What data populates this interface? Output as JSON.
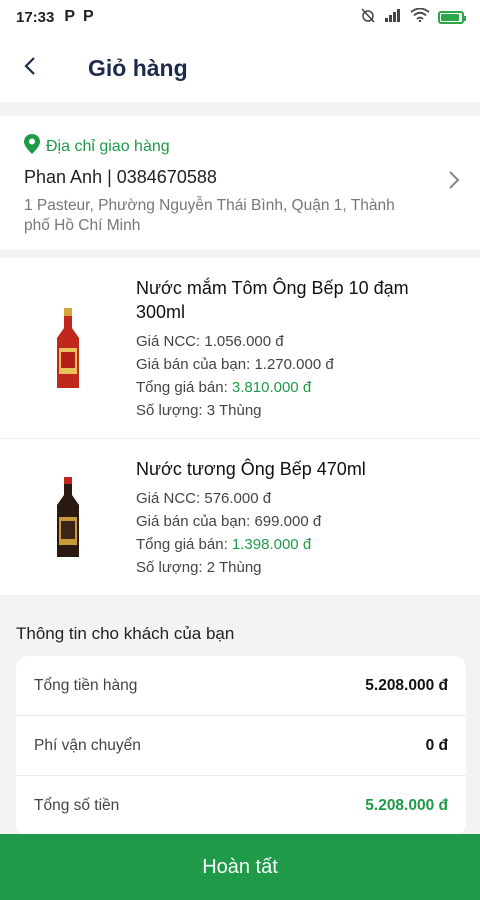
{
  "status_bar": {
    "time": "17:33",
    "badge1": "P",
    "badge2": "P",
    "battery_percent": 90
  },
  "header": {
    "title": "Giỏ hàng"
  },
  "address": {
    "label": "Địa chỉ giao hàng",
    "name_phone": "Phan Anh | 0384670588",
    "detail": "1 Pasteur, Phường Nguyễn Thái Bình, Quận 1, Thành phố Hồ Chí Minh"
  },
  "products": [
    {
      "name": "Nước mắm Tôm Ông Bếp 10 đạm 300ml",
      "ncc_label": "Giá NCC:",
      "ncc_value": "1.056.000 đ",
      "price_label": "Giá bán của bạn:",
      "price_value": "1.270.000 đ",
      "total_label": "Tổng giá bán:",
      "total_value": "3.810.000 đ",
      "qty_label": "Số lượng:",
      "qty_value": "3 Thùng",
      "bottle_color": "#c0281e"
    },
    {
      "name": "Nước tương Ông Bếp 470ml",
      "ncc_label": "Giá NCC:",
      "ncc_value": "576.000 đ",
      "price_label": "Giá bán của bạn:",
      "price_value": "699.000 đ",
      "total_label": "Tổng giá bán:",
      "total_value": "1.398.000 đ",
      "qty_label": "Số lượng:",
      "qty_value": "2 Thùng",
      "bottle_color": "#2a1a12"
    }
  ],
  "summary": {
    "title": "Thông tin cho khách của bạn",
    "rows": [
      {
        "label": "Tổng tiền hàng",
        "value": "5.208.000 đ"
      },
      {
        "label": "Phí vận chuyển",
        "value": "0 đ"
      },
      {
        "label": "Tổng số tiền",
        "value": "5.208.000 đ"
      }
    ]
  },
  "complete_button": {
    "label": "Hoàn tất"
  },
  "colors": {
    "accent": "#1f9a48",
    "title": "#1d2b4a"
  }
}
